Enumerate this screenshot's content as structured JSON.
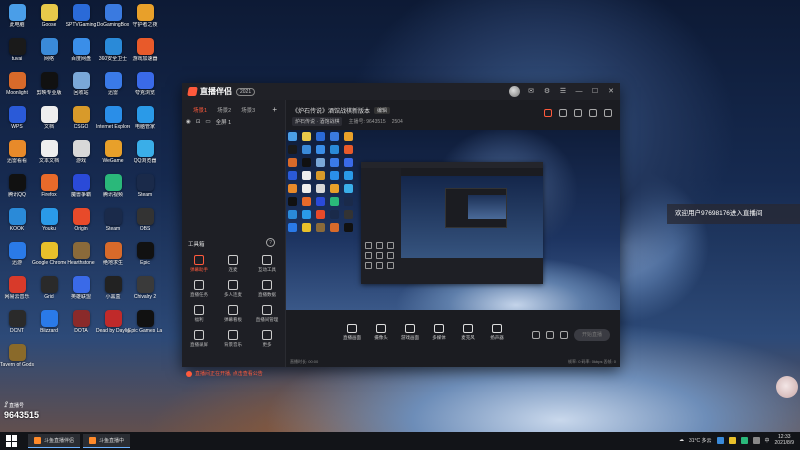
{
  "desktop": {
    "icons": [
      {
        "label": "此电脑",
        "color": "#4a9ee8"
      },
      {
        "label": "Goose",
        "color": "#e8c94a"
      },
      {
        "label": "SPTVGaming",
        "color": "#2a6ad8"
      },
      {
        "label": "DoGamingBox",
        "color": "#3a7ae0"
      },
      {
        "label": "守护者之夜",
        "color": "#e8a02a"
      },
      {
        "label": "tuvai",
        "color": "#1a1a1a"
      },
      {
        "label": "网络",
        "color": "#3a8ad8"
      },
      {
        "label": "百度网盘",
        "color": "#3a8ee8"
      },
      {
        "label": "360安全卫士",
        "color": "#2a8ad8"
      },
      {
        "label": "游戏加速器",
        "color": "#e85a2a"
      },
      {
        "label": "Moonlight",
        "color": "#d86a2a"
      },
      {
        "label": "剪映专业版",
        "color": "#111111"
      },
      {
        "label": "回收站",
        "color": "#7aa8d8"
      },
      {
        "label": "迅雷",
        "color": "#3a7ae8"
      },
      {
        "label": "夸克浏览",
        "color": "#3a6ae8"
      },
      {
        "label": "WPS",
        "color": "#2a5ad8"
      },
      {
        "label": "文档",
        "color": "#eeeeee"
      },
      {
        "label": "CSGO",
        "color": "#d89a2a"
      },
      {
        "label": "Internet Explorer",
        "color": "#2a8ee8"
      },
      {
        "label": "电脑管家",
        "color": "#2a9ae8"
      },
      {
        "label": "迅雷看看",
        "color": "#e88a2a"
      },
      {
        "label": "文本文档",
        "color": "#eeeeee"
      },
      {
        "label": "游戏",
        "color": "#d8d8d8"
      },
      {
        "label": "WeGame",
        "color": "#e8a02a"
      },
      {
        "label": "QQ浏览器",
        "color": "#3aaee8"
      },
      {
        "label": "腾讯QQ",
        "color": "#111111"
      },
      {
        "label": "Firefox",
        "color": "#e86a2a"
      },
      {
        "label": "魔兽争霸",
        "color": "#2a4ad8"
      },
      {
        "label": "腾讯视频",
        "color": "#2ab87a"
      },
      {
        "label": "Steam",
        "color": "#1a2a4a"
      },
      {
        "label": "KOOK",
        "color": "#2a8ad8"
      },
      {
        "label": "Youku",
        "color": "#2a9ae8"
      },
      {
        "label": "Origin",
        "color": "#e84a2a"
      },
      {
        "label": "Steam",
        "color": "#1a2a4a"
      },
      {
        "label": "OBS",
        "color": "#333333"
      },
      {
        "label": "迅游",
        "color": "#2a7ae8"
      },
      {
        "label": "Google Chrome",
        "color": "#e8c02a"
      },
      {
        "label": "Hearthstone",
        "color": "#8a6a3a"
      },
      {
        "label": "绝地求生",
        "color": "#d86a2a"
      },
      {
        "label": "Epic",
        "color": "#111111"
      },
      {
        "label": "网易云音乐",
        "color": "#d83a2a"
      },
      {
        "label": "Grid",
        "color": "#2a2a2a"
      },
      {
        "label": "英雄联盟",
        "color": "#3a6ae8"
      },
      {
        "label": "小黑盒",
        "color": "#222222"
      },
      {
        "label": "Chivalry 2",
        "color": "#3a3a3a"
      },
      {
        "label": "DCNT",
        "color": "#2a2a2a"
      },
      {
        "label": "Blizzard",
        "color": "#2a7ae8"
      },
      {
        "label": "DOTA",
        "color": "#8a2a2a"
      },
      {
        "label": "Dead by Daylight",
        "color": "#c02a2a"
      },
      {
        "label": "Epic Games Launcher",
        "color": "#111111"
      },
      {
        "label": "Tavern of Gods",
        "color": "#8a6a2a"
      }
    ]
  },
  "app": {
    "name": "直播伴侣",
    "version_badge": "2021",
    "left_tabs": [
      "场景1",
      "场景2",
      "场景3"
    ],
    "add_label": "+",
    "scene_name": "全屏 1",
    "tools_title": "工具箱",
    "help_glyph": "?",
    "tools": [
      {
        "label": "弹幕助手",
        "red": true
      },
      {
        "label": "连麦",
        "red": false
      },
      {
        "label": "互动工具",
        "red": false
      },
      {
        "label": "直播任务",
        "red": false
      },
      {
        "label": "多人连麦",
        "red": false
      },
      {
        "label": "直播数据",
        "red": false
      },
      {
        "label": "福利",
        "red": false
      },
      {
        "label": "弹幕看板",
        "red": false
      },
      {
        "label": "直播间管理",
        "red": false
      },
      {
        "label": "直播录屏",
        "red": false
      },
      {
        "label": "背景音乐",
        "red": false
      },
      {
        "label": "更多",
        "red": false
      }
    ],
    "notice": "直播间正在开播, 点击查看公告"
  },
  "room": {
    "title": "《炉石传说》酒馆战棋新版本",
    "edit_label": "编辑",
    "meta": [
      "炉石传说 · 酒馆战棋",
      "主播号: 9643515",
      "2504"
    ],
    "icons": [
      "gift",
      "lock",
      "share",
      "bell",
      "more"
    ]
  },
  "controls": {
    "items": [
      "直播画面",
      "摄像头",
      "游戏画面",
      "多媒体",
      "麦克风",
      "扬声器"
    ],
    "start_label": "开始直播",
    "status_left": "直播时长: 00:00",
    "status_right": "帧率: 0 码率: 0kbps 丢帧: 0"
  },
  "notification": "欢迎用户97698176进入直播间",
  "stream_id": {
    "label": "直播号",
    "number": "9643515"
  },
  "taskbar": {
    "tasks": [
      "斗鱼直播伴侣",
      "斗鱼直播中"
    ],
    "weather": "31°C 多云",
    "time": "12:33",
    "date": "2021/8/9"
  }
}
